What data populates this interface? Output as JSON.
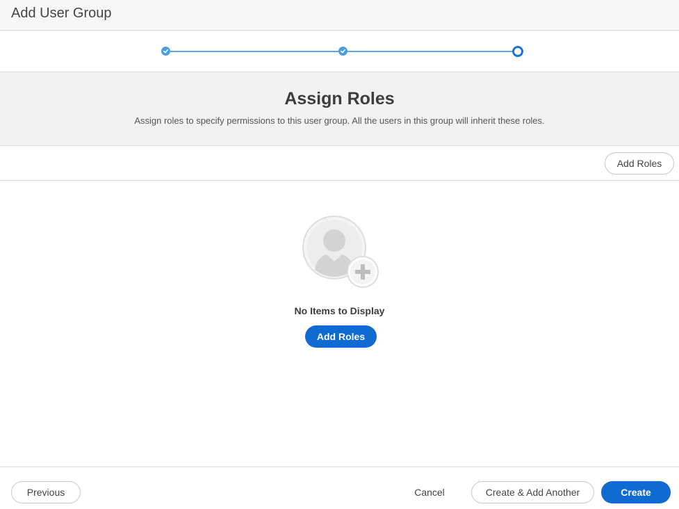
{
  "header": {
    "title": "Add User Group"
  },
  "stepper": {
    "steps": [
      {
        "state": "complete",
        "icon": "check-icon"
      },
      {
        "state": "complete",
        "icon": "check-icon"
      },
      {
        "state": "current",
        "icon": "ring-icon"
      }
    ],
    "colors": {
      "complete": "#4a9fe3",
      "current": "#1a73d8",
      "line": "#5aa7e6"
    }
  },
  "section": {
    "title": "Assign Roles",
    "description": "Assign roles to specify permissions to this user group. All the users in this group will inherit these roles."
  },
  "toolbar": {
    "add_roles_label": "Add Roles"
  },
  "empty_state": {
    "illustration": "user-add-icon",
    "message": "No Items to Display",
    "add_roles_label": "Add Roles"
  },
  "footer": {
    "previous_label": "Previous",
    "cancel_label": "Cancel",
    "create_another_label": "Create & Add Another",
    "create_label": "Create"
  },
  "colors": {
    "primary": "#0f6bd2"
  }
}
